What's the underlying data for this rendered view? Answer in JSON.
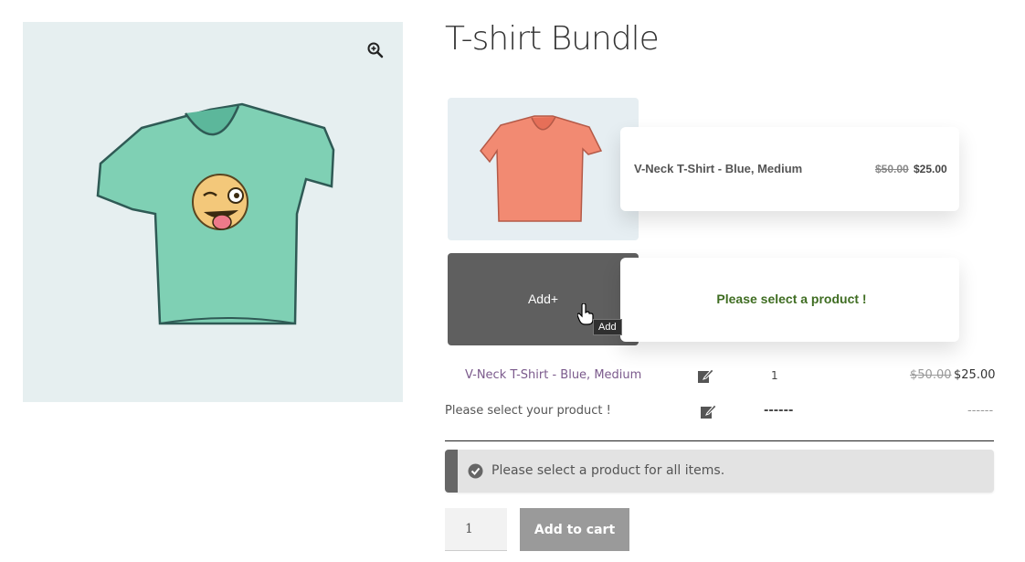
{
  "product": {
    "title": "T-shirt Bundle"
  },
  "gallery": {
    "zoom_icon": "zoom-in-icon"
  },
  "bundle": {
    "item1": {
      "name": "V-Neck T-Shirt - Blue, Medium",
      "old_price": "$50.00",
      "new_price": "$25.00"
    },
    "item2": {
      "add_label": "Add+",
      "tooltip": "Add",
      "message": "Please select a product !"
    }
  },
  "summary": {
    "row1": {
      "name": "V-Neck T-Shirt - Blue, Medium",
      "qty": "1",
      "old_price": "$50.00",
      "new_price": "$25.00"
    },
    "row2": {
      "name": "Please select your product !",
      "qty": "------",
      "price": "------"
    }
  },
  "notice": {
    "text": "Please select a product for all items."
  },
  "cart": {
    "qty": "1",
    "button_label": "Add to cart"
  },
  "colors": {
    "link": "#7b5a8c",
    "success": "#3f6d22",
    "gallery_bg": "#e6eff0",
    "tshirt_main": "#7fd0b4",
    "tshirt_thumb": "#f28a72"
  }
}
